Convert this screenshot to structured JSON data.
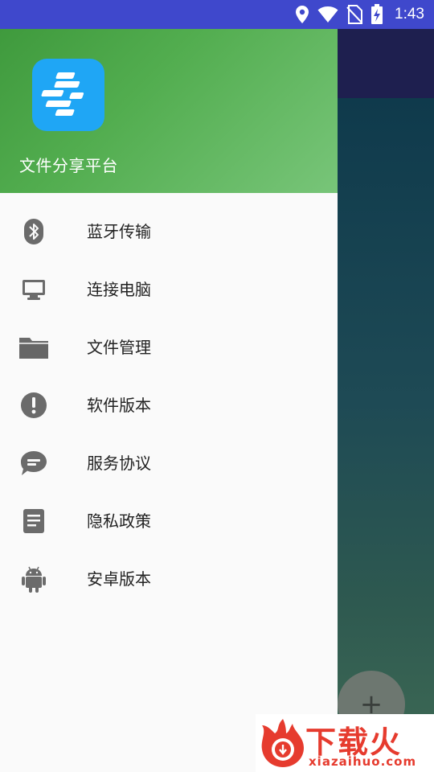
{
  "status_bar": {
    "time": "1:43",
    "icons": [
      "location-icon",
      "wifi-icon",
      "no-sim-icon",
      "battery-charging-icon"
    ]
  },
  "drawer": {
    "header": {
      "app_name": "文件分享平台",
      "logo_icon": "app-logo-icon"
    },
    "menu": [
      {
        "label": "蓝牙传输",
        "icon": "bluetooth-icon"
      },
      {
        "label": "连接电脑",
        "icon": "computer-icon"
      },
      {
        "label": "文件管理",
        "icon": "folder-icon"
      },
      {
        "label": "软件版本",
        "icon": "info-icon"
      },
      {
        "label": "服务协议",
        "icon": "chat-icon"
      },
      {
        "label": "隐私政策",
        "icon": "document-icon"
      },
      {
        "label": "安卓版本",
        "icon": "android-icon"
      }
    ]
  },
  "fab": {
    "label": "+"
  },
  "watermark": {
    "title": "下载火",
    "subtitle": "xiazaihuo.com"
  },
  "colors": {
    "status_bar": "#3f48cc",
    "header_gradient_start": "#3f9a3d",
    "header_gradient_end": "#78c579",
    "logo_bg": "#1fa6f5",
    "menu_icon": "#6b6b6b",
    "watermark": "#e63b2e"
  }
}
